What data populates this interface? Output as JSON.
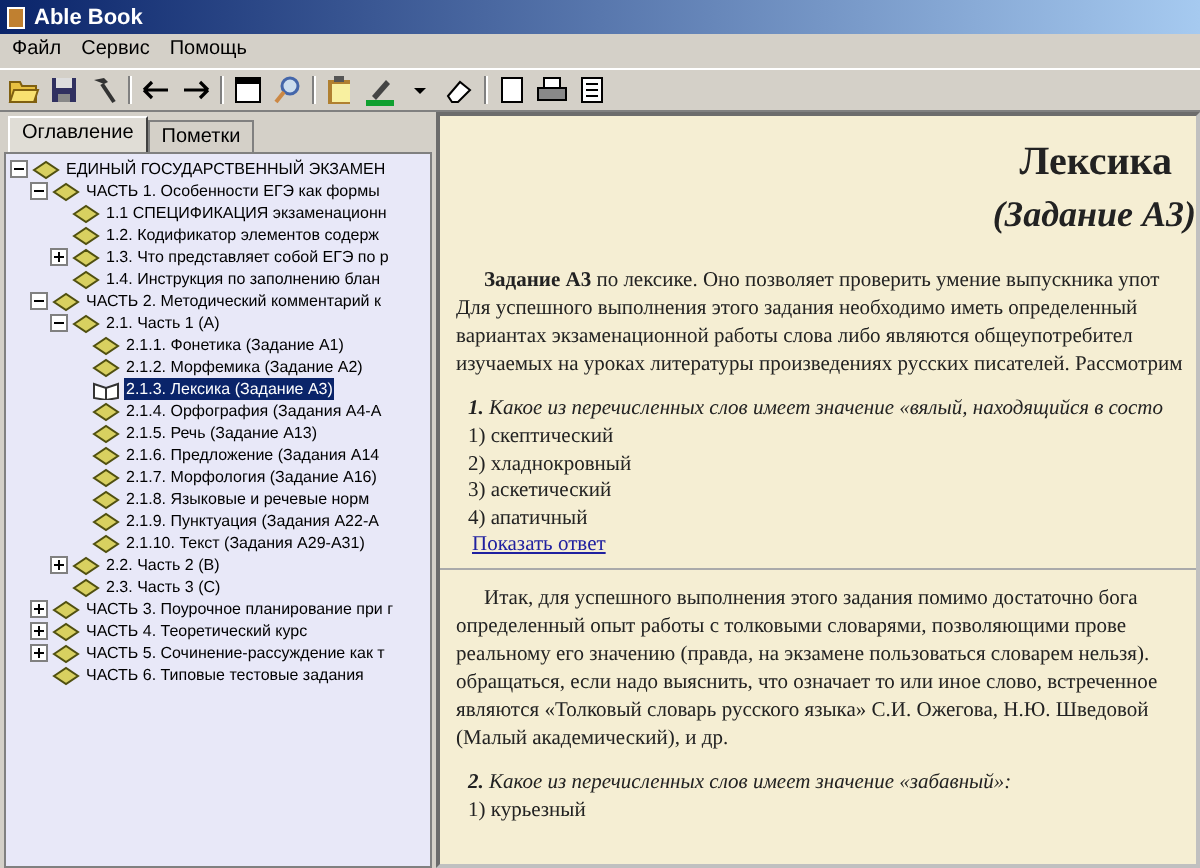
{
  "window": {
    "title": "Able Book"
  },
  "menu": [
    "Файл",
    "Сервис",
    "Помощь"
  ],
  "tabs": [
    {
      "label": "Оглавление",
      "selected": true
    },
    {
      "label": "Пометки",
      "selected": false
    }
  ],
  "tree": [
    {
      "label": "ЕДИНЫЙ ГОСУДАРСТВЕННЫЙ ЭКЗАМЕН",
      "expanded": true,
      "selected": false,
      "children": [
        {
          "label": "ЧАСТЬ 1. Особенности ЕГЭ как формы",
          "expanded": true,
          "selected": false,
          "children": [
            {
              "label": "1.1 СПЕЦИФИКАЦИЯ экзаменационн",
              "selected": false
            },
            {
              "label": "1.2. Кодификатор элементов содерж",
              "selected": false
            },
            {
              "label": "1.3. Что представляет собой ЕГЭ по р",
              "expanded": false,
              "selected": false
            },
            {
              "label": "1.4. Инструкция по заполнению блан",
              "selected": false
            }
          ]
        },
        {
          "label": "ЧАСТЬ 2. Методический комментарий к",
          "expanded": true,
          "selected": false,
          "children": [
            {
              "label": "2.1. Часть 1 (А)",
              "expanded": true,
              "selected": false,
              "children": [
                {
                  "label": "2.1.1. Фонетика (Задание А1)",
                  "selected": false
                },
                {
                  "label": "2.1.2. Морфемика (Задание А2)",
                  "selected": false
                },
                {
                  "label": "2.1.3. Лексика (Задание А3)",
                  "selected": true
                },
                {
                  "label": "2.1.4. Орфография (Задания А4-А",
                  "selected": false
                },
                {
                  "label": "2.1.5. Речь (Задание А13)",
                  "selected": false
                },
                {
                  "label": "2.1.6. Предложение (Задания А14",
                  "selected": false
                },
                {
                  "label": "2.1.7. Морфология (Задание А16)",
                  "selected": false
                },
                {
                  "label": "2.1.8. Языковые и речевые норм",
                  "selected": false
                },
                {
                  "label": "2.1.9. Пунктуация (Задания А22-А",
                  "selected": false
                },
                {
                  "label": "2.1.10. Текст (Задания А29-А31)",
                  "selected": false
                }
              ]
            },
            {
              "label": "2.2. Часть 2 (В)",
              "expanded": false,
              "selected": false
            },
            {
              "label": "2.3. Часть 3 (С)",
              "selected": false
            }
          ]
        },
        {
          "label": "ЧАСТЬ 3. Поурочное планирование при г",
          "expanded": false,
          "selected": false
        },
        {
          "label": "ЧАСТЬ 4. Теоретический курс",
          "expanded": false,
          "selected": false
        },
        {
          "label": "ЧАСТЬ 5. Сочинение-рассуждение как т",
          "expanded": false,
          "selected": false
        },
        {
          "label": "ЧАСТЬ 6. Типовые тестовые задания",
          "selected": false
        }
      ]
    }
  ],
  "content": {
    "title": "Лексика",
    "subtitle": "(Задание А3)",
    "blocks": [
      {
        "kind": "paragraph",
        "lines": [
          "**Задание А3** по лексике. Оно позволяет проверить умение выпускника упот",
          "Для успешного выполнения этого задания необходимо иметь определенный",
          "вариантах экзаменационной работы слова либо являются общеупотребител",
          "изучаемых на уроках литературы произведениях русских писателей. Рассмотрим"
        ]
      },
      {
        "kind": "question",
        "number": "1.",
        "prompt": "Какое из перечисленных слов имеет значение «вялый, находящийся в состо",
        "options": [
          "1) скептический",
          "2) хладнокровный",
          "3) аскетический",
          "4) апатичный"
        ]
      },
      {
        "kind": "link",
        "text": "Показать ответ"
      },
      {
        "kind": "rule"
      },
      {
        "kind": "paragraph",
        "lines": [
          "Итак, для успешного выполнения этого задания помимо достаточно бога",
          "определенный опыт работы с толковыми словарями, позволяющими прове",
          "реальному его значению (правда, на экзамене пользоваться словарем нельзя).",
          "обращаться, если надо выяснить, что означает то или иное слово, встреченное",
          "являются «Толковый словарь русского языка» С.И. Ожегова, Н.Ю. Шведовой",
          "(Малый академический), и др."
        ]
      },
      {
        "kind": "question",
        "number": "2.",
        "prompt": "Какое из перечисленных слов имеет значение «забавный»:",
        "options": [
          "1) курьезный"
        ]
      }
    ]
  }
}
